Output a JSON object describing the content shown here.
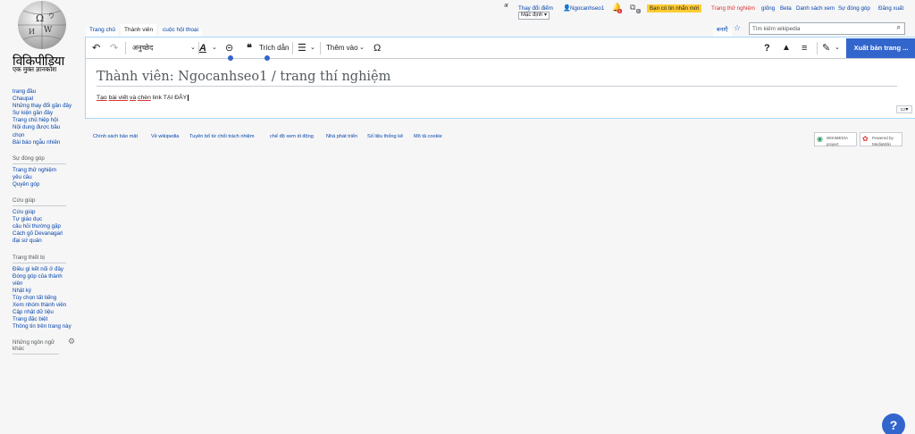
{
  "logo": {
    "wordmark": "विकिपीडिया",
    "tagline": "एक मुक्त ज्ञानकोश"
  },
  "personal_tools": {
    "hindi_toggle": "अ",
    "changes_link": "Thay đổi điểm",
    "variant_select": "Mặc định",
    "username": "Ngocanhseo1",
    "notif_count": "1",
    "msg_count": "0",
    "new_messages": "Bạn có tin nhắn mới",
    "sandbox": "Trang thử nghiệm",
    "preferences": "giống",
    "beta": "Beta",
    "watchlist": "Danh sách xem",
    "contributions": "Sự đóng góp",
    "logout": "Đăng xuất"
  },
  "tabs": {
    "main_page": "Trang chủ",
    "user": "Thành viên",
    "talk": "cuộc hội thoại"
  },
  "right_tabs": {
    "language_tab": "बनाएँ"
  },
  "search": {
    "placeholder": "Tìm kiếm wikipedia"
  },
  "sidebar": {
    "nav": [
      "trang đầu",
      "Chaupal",
      "Những thay đổi gần đây",
      "Sự kiện gần đây",
      "Trang chủ hiệp hội",
      "Nội dung được bầu chọn",
      "Bài báo ngẫu nhiên"
    ],
    "contribute_heading": "Sự đóng góp",
    "contribute": [
      "Trang thử nghiệm",
      "yêu cầu",
      "Quyên góp"
    ],
    "help_heading": "Cứu giúp",
    "help": [
      "Cứu giúp",
      "Tự giáo dục",
      "câu hỏi thường gặp",
      "Cách gõ Devanagari",
      "đại sứ quán"
    ],
    "tools_heading": "Trang thiết bị",
    "tools": [
      "Điều gì kết nối ở đây",
      "Đóng góp của thành viên",
      "Nhật ký",
      "Tùy chọn tất tiếng",
      "Xem nhóm thành viên",
      "Cập nhật dữ liệu",
      "Trang đặc biệt",
      "Thông tin trên trang này"
    ],
    "languages_heading": "Những ngôn ngữ khác"
  },
  "toolbar": {
    "paragraph": "अनुच्छेद",
    "cite": "Trích dẫn",
    "insert": "Thêm vào",
    "publish": "Xuất bản trang ..."
  },
  "page": {
    "title": "Thành viên: Ngocanhseo1 / trang thí nghiệm",
    "body_link1": "Tạo",
    "body_link2": "bài viết",
    "body_link3": "và",
    "body_link4": "chèn",
    "body_rest": "link TẠI ĐÂY"
  },
  "footer": {
    "links": [
      "Chính sách bảo mật",
      "Về wikipedia",
      "Tuyên bố từ chối trách nhiệm",
      "chế độ xem di động",
      "Nhà phát triển",
      "Số liệu thống kê",
      "Mô tả cookie"
    ],
    "wikimedia_badge": "WIKIMEDIA project",
    "mediawiki_badge": "Powered by MediaWiki"
  },
  "colors": {
    "accent": "#3366cc",
    "link": "#0645ad",
    "new_message_bg": "#fc3",
    "sandbox_red": "#d33"
  }
}
